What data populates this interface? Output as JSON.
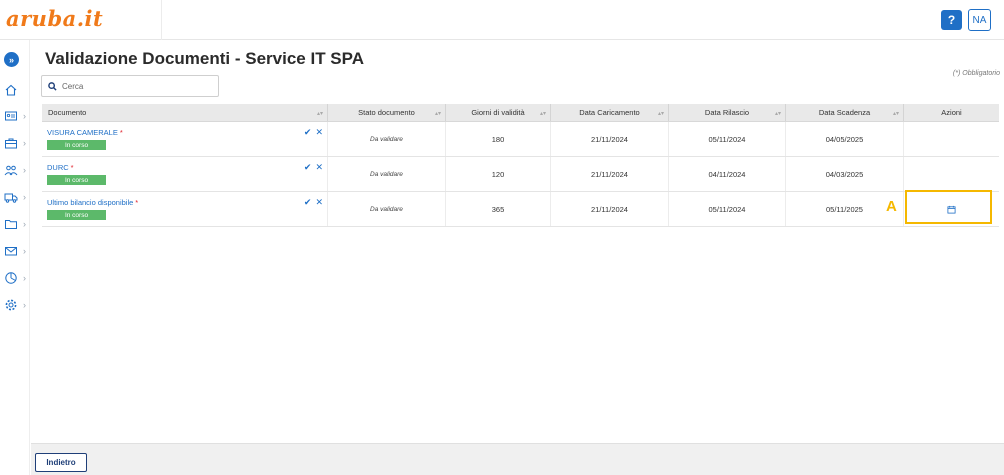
{
  "app": {
    "logo_text": "aruba.it",
    "help_label": "?",
    "user_initials": "NA"
  },
  "page": {
    "title": "Validazione Documenti - Service IT SPA",
    "required_note": "(*) Obbligatorio",
    "search_placeholder": "Cerca"
  },
  "sidebar": {
    "expand_icon": "double-chevron-right-icon",
    "items": [
      {
        "icon": "home-icon",
        "has_submenu": false
      },
      {
        "icon": "id-card-icon",
        "has_submenu": true
      },
      {
        "icon": "briefcase-icon",
        "has_submenu": true
      },
      {
        "icon": "users-icon",
        "has_submenu": true
      },
      {
        "icon": "truck-icon",
        "has_submenu": true
      },
      {
        "icon": "folder-icon",
        "has_submenu": true
      },
      {
        "icon": "mail-icon",
        "has_submenu": true
      },
      {
        "icon": "pie-chart-icon",
        "has_submenu": true
      },
      {
        "icon": "gear-icon",
        "has_submenu": true
      }
    ]
  },
  "table": {
    "headers": [
      "Documento",
      "Stato documento",
      "Giorni di validità",
      "Data Caricamento",
      "Data Rilascio",
      "Data Scadenza",
      "Azioni"
    ],
    "rows": [
      {
        "documento": "VISURA CAMERALE",
        "required": "*",
        "badge": "In corso",
        "stato": "Da validare",
        "giorni": "180",
        "caricamento": "21/11/2024",
        "rilascio": "05/11/2024",
        "scadenza": "04/05/2025"
      },
      {
        "documento": "DURC",
        "required": "*",
        "badge": "In corso",
        "stato": "Da validare",
        "giorni": "120",
        "caricamento": "21/11/2024",
        "rilascio": "04/11/2024",
        "scadenza": "04/03/2025"
      },
      {
        "documento": "Ultimo bilancio disponibile",
        "required": "*",
        "badge": "In corso",
        "stato": "Da validare",
        "giorni": "365",
        "caricamento": "21/11/2024",
        "rilascio": "05/11/2024",
        "scadenza": "05/11/2025"
      }
    ],
    "highlight_label": "A"
  },
  "footer": {
    "back_label": "Indietro"
  },
  "colors": {
    "brand": "#f07a1a",
    "accent": "#1f6fc6",
    "badge": "#5cb96a",
    "highlight": "#f5b800"
  }
}
